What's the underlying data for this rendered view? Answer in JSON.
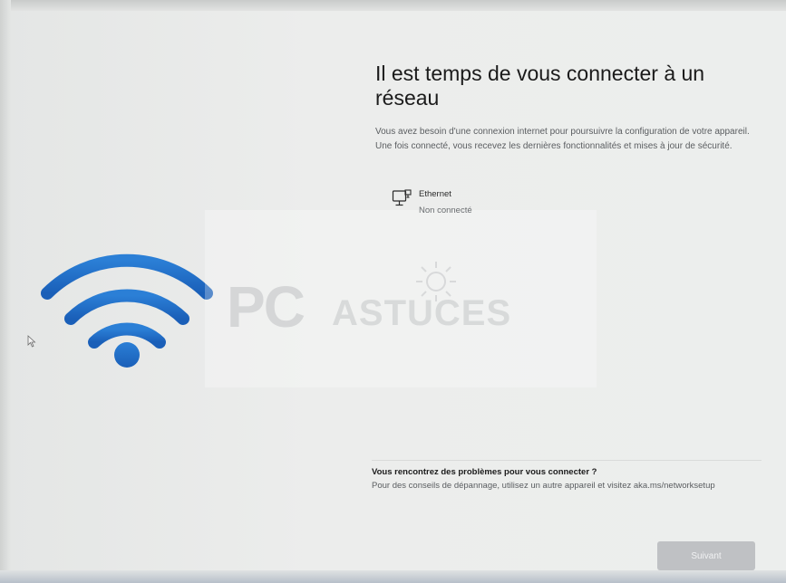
{
  "page": {
    "title": "Il est temps de vous connecter à un réseau",
    "description": "Vous avez besoin d'une connexion internet pour poursuivre la configuration de votre appareil. Une fois connecté, vous recevez les dernières fonctionnalités et mises à jour de sécurité."
  },
  "networks": [
    {
      "name": "Ethernet",
      "status": "Non connecté",
      "icon": "ethernet-monitor-icon"
    }
  ],
  "help": {
    "title": "Vous rencontrez des problèmes pour vous connecter ?",
    "text": "Pour des conseils de dépannage, utilisez un autre appareil et visitez aka.ms/networksetup"
  },
  "buttons": {
    "next_label": "Suivant"
  },
  "watermark": {
    "pc": "PC",
    "astuces": "ASTUCES"
  },
  "colors": {
    "wifi_icon": "#1e6fc9",
    "next_button_disabled": "#bfc1c4",
    "background": "#eceeed"
  },
  "icons": {
    "hero": "wifi-icon",
    "pointer": "mouse-cursor-icon"
  }
}
